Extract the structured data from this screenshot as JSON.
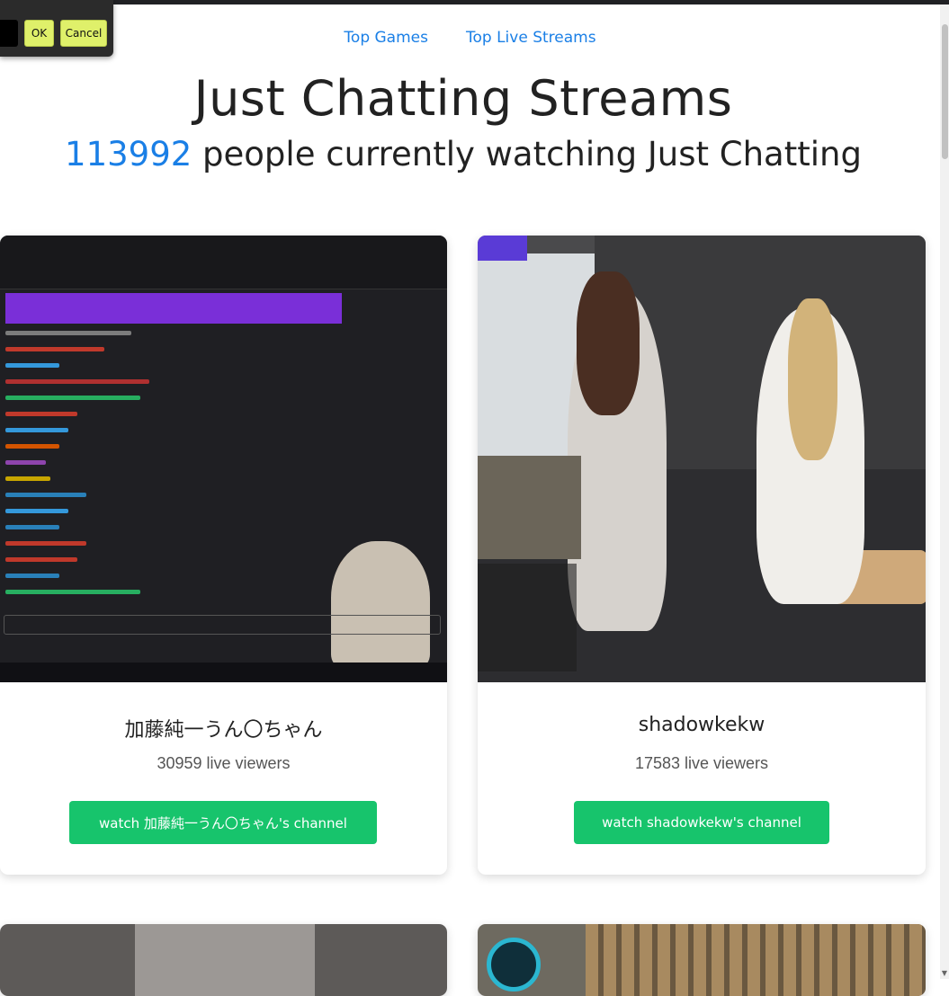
{
  "dialog": {
    "ok_label": "OK",
    "cancel_label": "Cancel"
  },
  "nav": {
    "links": [
      {
        "label": "Top Games"
      },
      {
        "label": "Top Live Streams"
      }
    ]
  },
  "header": {
    "title": "Just Chatting Streams",
    "viewer_count": "113992",
    "subtitle_suffix": " people currently watching Just Chatting"
  },
  "streams": [
    {
      "name": "加藤純一うん〇ちゃん",
      "viewers": "30959 live viewers",
      "button_label": "watch 加藤純一うん〇ちゃん's channel"
    },
    {
      "name": "shadowkekw",
      "viewers": "17583 live viewers",
      "button_label": "watch shadowkekw's channel"
    }
  ],
  "colors": {
    "accent": "#1a7fe6",
    "button": "#17c46c",
    "dialog_button": "#dff06a"
  }
}
